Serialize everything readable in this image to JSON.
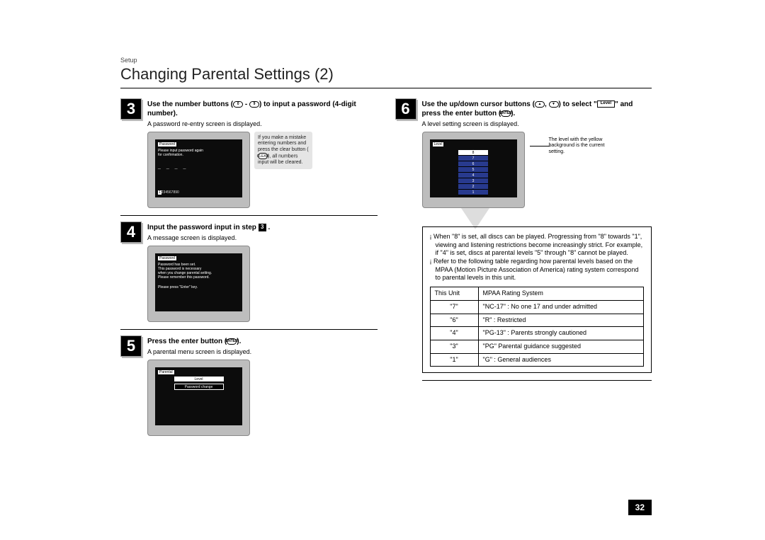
{
  "breadcrumb": "Setup",
  "pageTitle": "Changing Parental Settings (2)",
  "pageNumber": "32",
  "buttons": {
    "num0": "0",
    "num9": "9",
    "clear": "CLEAR",
    "enter": "ENTER",
    "up": "▲",
    "down": "▼",
    "level": "Level"
  },
  "step3": {
    "num": "3",
    "title_a": "Use the number buttons (",
    "title_b": " - ",
    "title_c": ") to input a password (4-digit number).",
    "sub": "A password re-entry screen is displayed.",
    "calloutText": "If you make a mistake entering numbers and press the clear button (",
    "calloutText2": "), all numbers input will be cleared.",
    "screen": {
      "label": "Password",
      "line1": "Please input password again",
      "line2": "for confirmation.",
      "dashes": "_ _ _ _",
      "numrow": "234567890",
      "numhl": "1"
    }
  },
  "step4": {
    "num": "4",
    "titleA": "Input the password input in step ",
    "titleB": " .",
    "refBox": "3",
    "sub": "A message screen is displayed.",
    "screen": {
      "label": "Password",
      "l1": "Password has been set.",
      "l2": "This password is necessary",
      "l3": "when you change parental setting.",
      "l4": "Please remember this password.",
      "l5": "Please press \"Enter\" key."
    }
  },
  "step5": {
    "num": "5",
    "titleA": "Press the enter button (",
    "titleB": ").",
    "sub": "A parental menu screen is displayed.",
    "screen": {
      "label": "Parental",
      "itemLevel": "Level",
      "itemPw": "Password change"
    }
  },
  "step6": {
    "num": "6",
    "titleA": "Use the up/down cursor buttons (",
    "titleB": ", ",
    "titleC": ") to select \"",
    "titleD": "\" and press the enter button (",
    "titleE": ").",
    "sub": "A level setting screen is displayed.",
    "screen": {
      "label": "Level",
      "levels": [
        "8",
        "7",
        "6",
        "5",
        "4",
        "3",
        "2",
        "1"
      ]
    },
    "sideNote": "The level with the yellow background is the current setting."
  },
  "infoBullets": [
    "When \"8\" is set, all discs can be played. Progressing from \"8\" towards \"1\", viewing and listening restrictions become increasingly strict. For example, if \"4\" is set, discs at parental levels \"5\" through \"8\" cannot be played.",
    "Refer to the following table regarding how parental levels based on the MPAA (Motion Picture Association of America) rating system correspond to parental levels in this unit."
  ],
  "mpaaHeaders": {
    "unit": "This Unit",
    "system": "MPAA Rating System"
  },
  "mpaaRows": [
    {
      "unit": "\"7\"",
      "desc": "\"NC-17\" : No one 17 and under admitted"
    },
    {
      "unit": "\"6\"",
      "desc": "\"R\" : Restricted"
    },
    {
      "unit": "\"4\"",
      "desc": "\"PG-13\" : Parents strongly cautioned"
    },
    {
      "unit": "\"3\"",
      "desc": "\"PG\" Parental guidance suggested"
    },
    {
      "unit": "\"1\"",
      "desc": "\"G\" : General audiences"
    }
  ]
}
